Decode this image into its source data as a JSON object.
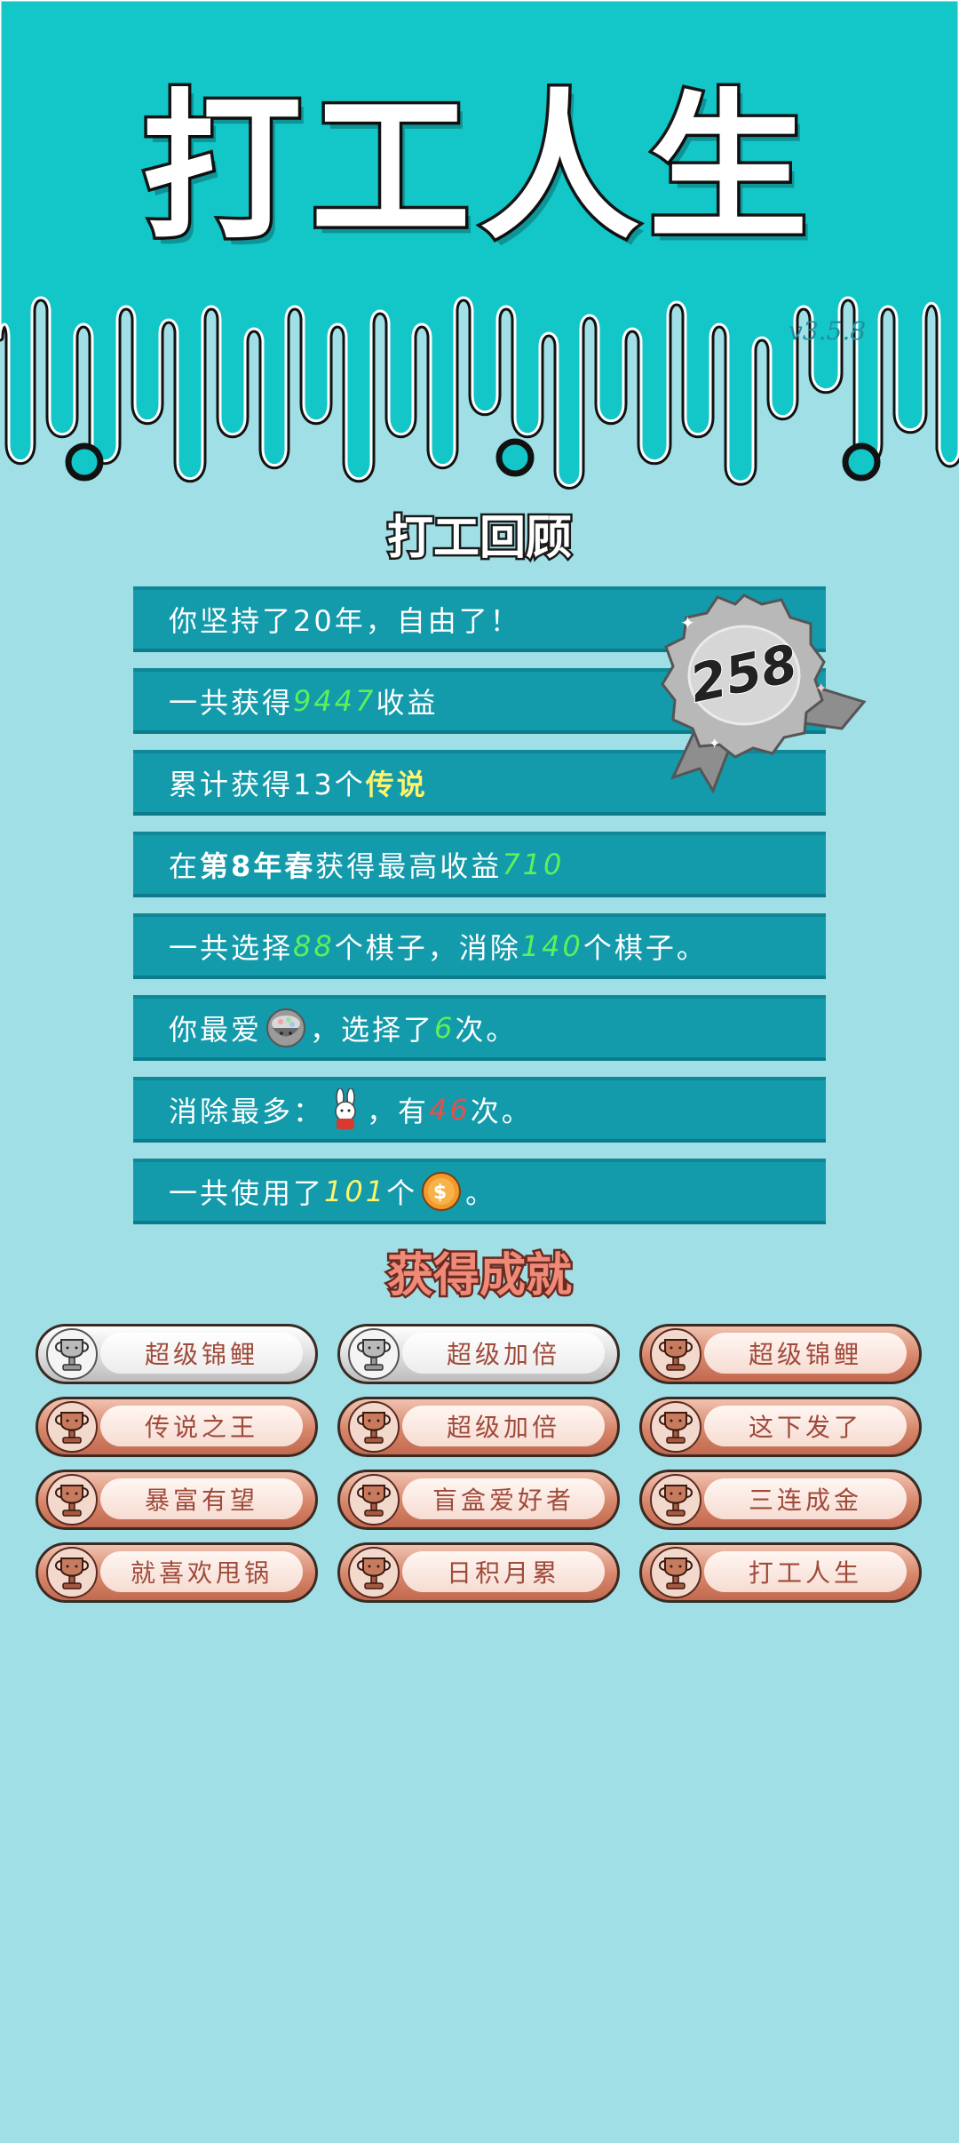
{
  "app": {
    "title": "打工人生",
    "version": "v3.5.8"
  },
  "review": {
    "title": "打工回顾",
    "badge_number": "258",
    "rows": [
      {
        "pre": "你坚持了20年，自由了！"
      },
      {
        "pre": "一共获得",
        "value": "9447",
        "post": "收益"
      },
      {
        "pre": "累计获得13个",
        "value": "传说"
      },
      {
        "pre": "在 ",
        "bold": "第8年春",
        "mid": " 获得最高收益",
        "value": "710"
      },
      {
        "pre": "一共选择",
        "value": "88",
        "mid": "个棋子，消除",
        "value2": "140",
        "post": "个棋子。"
      },
      {
        "pre": "你最爱",
        "mid": "，选择了",
        "value": "6",
        "post": "次。"
      },
      {
        "pre": "消除最多：",
        "mid": "，有",
        "value": "46",
        "post": "次。"
      },
      {
        "pre": "一共使用了",
        "value": "101",
        "mid": "个",
        "post": "。"
      }
    ]
  },
  "achievements": {
    "title": "获得成就",
    "items": [
      {
        "label": "超级锦鲤",
        "tier": "silver"
      },
      {
        "label": "超级加倍",
        "tier": "silver"
      },
      {
        "label": "超级锦鲤",
        "tier": "bronze"
      },
      {
        "label": "传说之王",
        "tier": "bronze"
      },
      {
        "label": "超级加倍",
        "tier": "bronze"
      },
      {
        "label": "这下发了",
        "tier": "bronze"
      },
      {
        "label": "暴富有望",
        "tier": "bronze"
      },
      {
        "label": "盲盒爱好者",
        "tier": "bronze"
      },
      {
        "label": "三连成金",
        "tier": "bronze"
      },
      {
        "label": "就喜欢甩锅",
        "tier": "bronze"
      },
      {
        "label": "日积月累",
        "tier": "bronze"
      },
      {
        "label": "打工人生",
        "tier": "bronze"
      }
    ]
  },
  "colors": {
    "header_bg": "#13c6c8",
    "body_bg": "#a0dfe6",
    "row_bg": "#139aab",
    "highlight_green": "#5cf05a",
    "highlight_yellow": "#fff36a",
    "highlight_red": "#e6504a"
  }
}
